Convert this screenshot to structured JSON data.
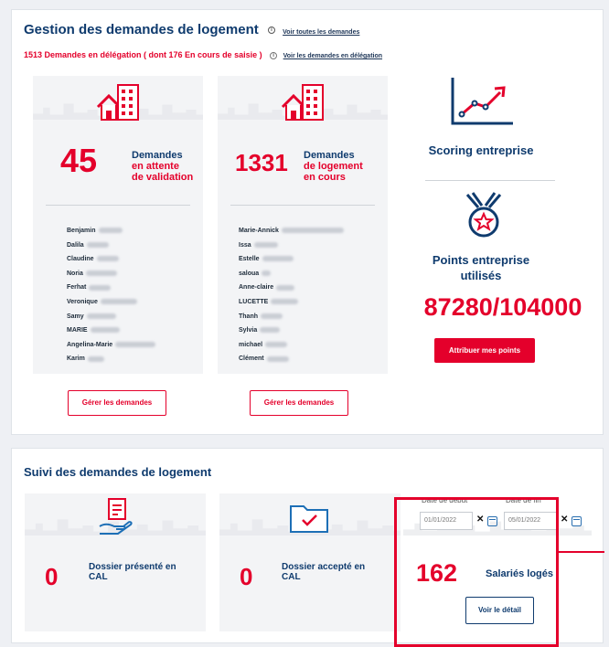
{
  "header": {
    "title": "Gestion des demandes de logement",
    "see_all_link": "Voir toutes les demandes",
    "delegation_text": "1513 Demandes en délégation ( dont 176 En cours de saisie )",
    "delegation_link": "Voir les demandes en délégation"
  },
  "card_pending": {
    "count": "45",
    "label_line1": "Demandes",
    "label_line2": "en attente",
    "label_line3": "de validation",
    "names": [
      "Benjamin",
      "Dalila",
      "Claudine",
      "Noria",
      "Ferhat",
      "Veronique",
      "Samy",
      "MARIE",
      "Angelina-Marie",
      "Karim"
    ],
    "button": "Gérer les demandes"
  },
  "card_inprogress": {
    "count": "1331",
    "label_line1": "Demandes",
    "label_line2": "de logement",
    "label_line3": "en cours",
    "names": [
      "Marie-Annick",
      "Issa",
      "Estelle",
      "saloua",
      "Anne-claire",
      "LUCETTE",
      "Thanh",
      "Sylvia",
      "michael",
      "Clément"
    ],
    "button": "Gérer les demandes"
  },
  "scoring": {
    "label": "Scoring entreprise"
  },
  "points": {
    "label_line1": "Points entreprise",
    "label_line2": "utilisés",
    "value": "87280/104000",
    "button": "Attribuer mes points"
  },
  "suivi": {
    "title": "Suivi des demandes de logement",
    "presented_count": "0",
    "presented_label_line1": "Dossier présenté en",
    "presented_label_line2": "CAL",
    "accepted_count": "0",
    "accepted_label_line1": "Dossier accepté en",
    "accepted_label_line2": "CAL",
    "start_label": "Date de debut",
    "end_label": "Date de fin",
    "start_value": "01/01/2022",
    "end_value": "05/01/2022",
    "housed_count": "162",
    "housed_label": "Salariés logés",
    "detail_button": "Voir le détail"
  },
  "colors": {
    "accent": "#e4002b",
    "navy": "#0f3b6e"
  }
}
